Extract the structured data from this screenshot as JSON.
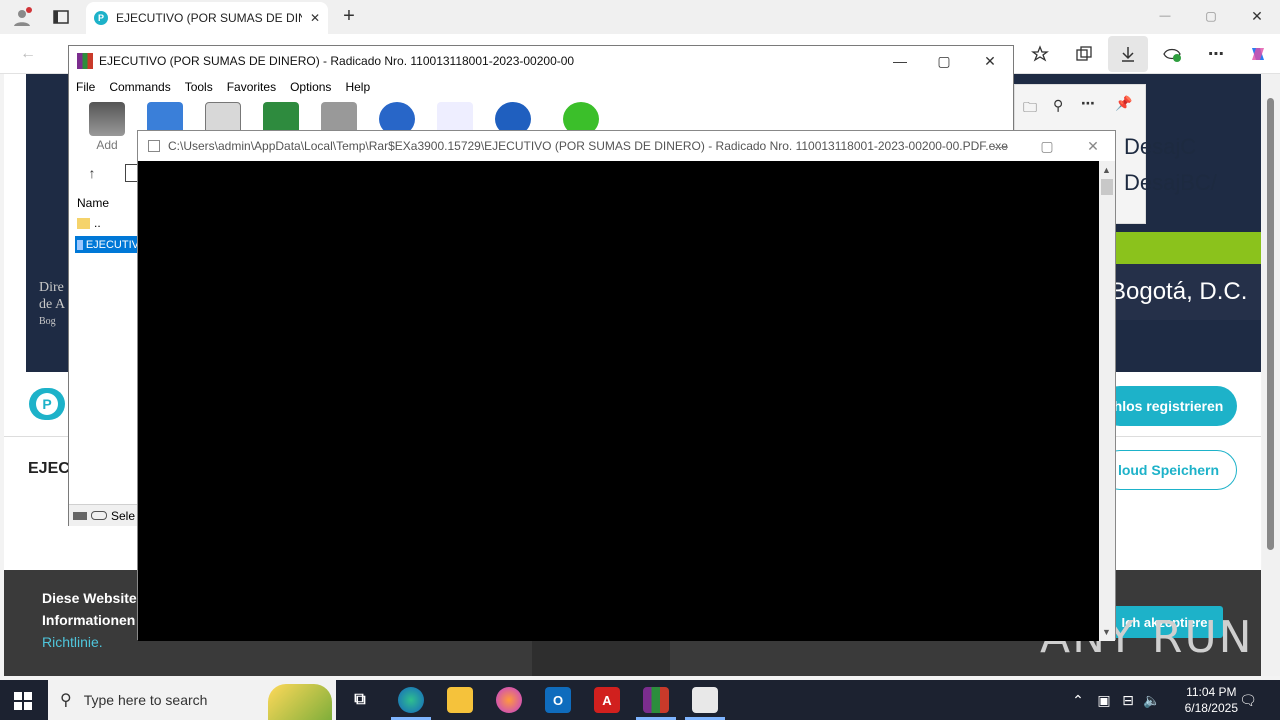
{
  "browser": {
    "tab_title": "EJECUTIVO (POR SUMAS DE DINE",
    "favicon_letter": "P",
    "new_tab": "+",
    "window_controls": {
      "minimize": "—",
      "maximize": "▢",
      "close": "✕"
    },
    "toolbar_icons": [
      "favorites-star-icon",
      "collections-icon",
      "download-icon",
      "extensions-icon",
      "more-icon",
      "copilot-icon"
    ]
  },
  "webpage": {
    "hero_left_lines": [
      "Dire",
      "de A",
      "Bog"
    ],
    "social": [
      "DesajC",
      "DesajBC/"
    ],
    "hero_city": "Bogotá, D.C.",
    "register_button": "hlos registrieren",
    "cloud_button": "loud Speichern",
    "heading_partial": "EJEC",
    "cookie_text_line1": "Diese Website v",
    "cookie_text_line2": "Informationen z",
    "cookie_link": "Richtlinie.",
    "accept_button": "Ich akzeptiere",
    "watermark": "ANY RUN"
  },
  "winrar": {
    "title": "EJECUTIVO (POR SUMAS DE DINERO) - Radicado Nro. 110013118001-2023-00200-00",
    "menu": [
      "File",
      "Commands",
      "Tools",
      "Favorites",
      "Options",
      "Help"
    ],
    "add_label": "Add",
    "column_name": "Name",
    "parent_dir": "..",
    "selected_file": "EJECUTIV",
    "status_text": "Sele"
  },
  "console": {
    "title": "C:\\Users\\admin\\AppData\\Local\\Temp\\Rar$EXa3900.15729\\EJECUTIVO (POR SUMAS DE DINERO) - Radicado Nro. 110013118001-2023-00200-00.PDF.exe"
  },
  "taskbar": {
    "search_placeholder": "Type here to search",
    "time": "11:04 PM",
    "date": "6/18/2025"
  },
  "colors": {
    "accent_teal": "#1db2c9",
    "hero_navy": "#1e2b44",
    "taskbar": "#1c2230"
  }
}
